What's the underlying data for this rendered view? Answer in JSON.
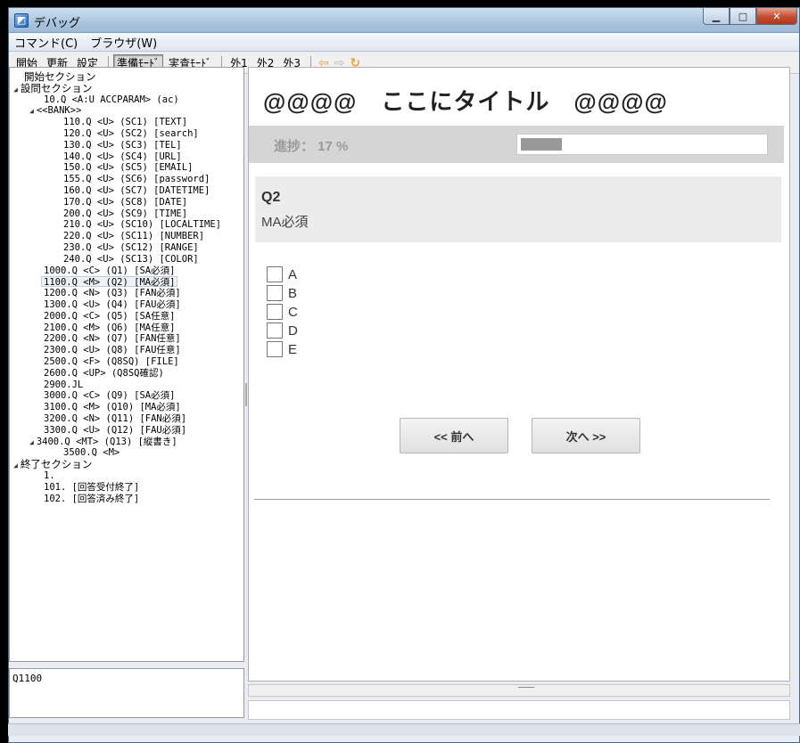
{
  "window": {
    "title": "デバッグ"
  },
  "menu": [
    "コマンド(C)",
    "ブラウザ(W)"
  ],
  "toolbar": {
    "start": "開始",
    "refresh": "更新",
    "settings": "設定",
    "prep_mode": "準備ﾓｰﾄﾞ",
    "exam_mode": "実査ﾓｰﾄﾞ",
    "ext1": "外1",
    "ext2": "外2",
    "ext3": "外3"
  },
  "tree": [
    {
      "indent": 14,
      "expander": "",
      "text": "開始セクション",
      "jp": true
    },
    {
      "indent": 2,
      "expander": "◢",
      "text": "設問セクション",
      "jp": true
    },
    {
      "indent": 36,
      "expander": "",
      "text": "10.Q <A:U ACCPARAM> (ac)"
    },
    {
      "indent": 20,
      "expander": "◢",
      "text": "<<BANK>>"
    },
    {
      "indent": 58,
      "expander": "",
      "text": "110.Q <U> (SC1) [TEXT]"
    },
    {
      "indent": 58,
      "expander": "",
      "text": "120.Q <U> (SC2) [search]"
    },
    {
      "indent": 58,
      "expander": "",
      "text": "130.Q <U> (SC3) [TEL]"
    },
    {
      "indent": 58,
      "expander": "",
      "text": "140.Q <U> (SC4) [URL]"
    },
    {
      "indent": 58,
      "expander": "",
      "text": "150.Q <U> (SC5) [EMAIL]"
    },
    {
      "indent": 58,
      "expander": "",
      "text": "155.Q <U> (SC6) [password]"
    },
    {
      "indent": 58,
      "expander": "",
      "text": "160.Q <U> (SC7) [DATETIME]"
    },
    {
      "indent": 58,
      "expander": "",
      "text": "170.Q <U> (SC8) [DATE]"
    },
    {
      "indent": 58,
      "expander": "",
      "text": "200.Q <U> (SC9) [TIME]"
    },
    {
      "indent": 58,
      "expander": "",
      "text": "210.Q <U> (SC10) [LOCALTIME]"
    },
    {
      "indent": 58,
      "expander": "",
      "text": "220.Q <U> (SC11) [NUMBER]"
    },
    {
      "indent": 58,
      "expander": "",
      "text": "230.Q <U> (SC12) [RANGE]"
    },
    {
      "indent": 58,
      "expander": "",
      "text": "240.Q <U> (SC13) [COLOR]"
    },
    {
      "indent": 36,
      "expander": "",
      "text": "1000.Q <C> (Q1) [SA必須]"
    },
    {
      "indent": 36,
      "expander": "",
      "text": "1100.Q <M> (Q2) [MA必須]",
      "selected": true
    },
    {
      "indent": 36,
      "expander": "",
      "text": "1200.Q <N> (Q3) [FAN必須]"
    },
    {
      "indent": 36,
      "expander": "",
      "text": "1300.Q <U> (Q4) [FAU必須]"
    },
    {
      "indent": 36,
      "expander": "",
      "text": "2000.Q <C> (Q5) [SA任意]"
    },
    {
      "indent": 36,
      "expander": "",
      "text": "2100.Q <M> (Q6) [MA任意]"
    },
    {
      "indent": 36,
      "expander": "",
      "text": "2200.Q <N> (Q7) [FAN任意]"
    },
    {
      "indent": 36,
      "expander": "",
      "text": "2300.Q <U> (Q8) [FAU任意]"
    },
    {
      "indent": 36,
      "expander": "",
      "text": "2500.Q <F> (Q8SQ) [FILE]"
    },
    {
      "indent": 36,
      "expander": "",
      "text": "2600.Q <UP> (Q8SQ確認)"
    },
    {
      "indent": 36,
      "expander": "",
      "text": "2900.JL"
    },
    {
      "indent": 36,
      "expander": "",
      "text": "3000.Q <C> (Q9) [SA必須]"
    },
    {
      "indent": 36,
      "expander": "",
      "text": "3100.Q <M> (Q10) [MA必須]"
    },
    {
      "indent": 36,
      "expander": "",
      "text": "3200.Q <N> (Q11) [FAN必須]"
    },
    {
      "indent": 36,
      "expander": "",
      "text": "3300.Q <U> (Q12) [FAU必須]"
    },
    {
      "indent": 20,
      "expander": "◢",
      "text": "3400.Q <MT> (Q13) [縦書き]"
    },
    {
      "indent": 58,
      "expander": "",
      "text": "3500.Q <M>"
    },
    {
      "indent": 2,
      "expander": "◢",
      "text": "終了セクション",
      "jp": true
    },
    {
      "indent": 36,
      "expander": "",
      "text": "1."
    },
    {
      "indent": 36,
      "expander": "",
      "text": "101. [回答受付終了]"
    },
    {
      "indent": 36,
      "expander": "",
      "text": "102. [回答済み終了]"
    }
  ],
  "command": {
    "value": "Q1100"
  },
  "page": {
    "title": "@@@@　ここにタイトル　@@@@",
    "progress_label": "進捗：  17 %",
    "progress_value": 0.17,
    "question_no": "Q2",
    "question_desc": "MA必須",
    "options": [
      "A",
      "B",
      "C",
      "D",
      "E"
    ],
    "prev_label": "<< 前へ",
    "next_label": "次へ >>"
  }
}
